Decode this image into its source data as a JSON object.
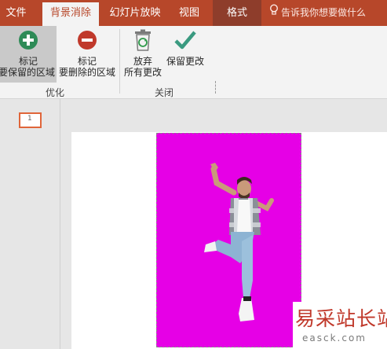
{
  "tabs": [
    {
      "label": "文件"
    },
    {
      "label": "背景消除"
    },
    {
      "label": "幻灯片放映"
    },
    {
      "label": "视图"
    },
    {
      "label": "格式"
    }
  ],
  "tell_me": "告诉我你想要做什么",
  "ribbon": {
    "mark_keep": {
      "line1": "标记",
      "line2": "要保留的区域",
      "icon": "plus-circle-icon"
    },
    "mark_remove": {
      "line1": "标记",
      "line2": "要删除的区域",
      "icon": "minus-circle-icon"
    },
    "discard": {
      "line1": "放弃",
      "line2": "所有更改",
      "icon": "recycle-bin-icon"
    },
    "keep": {
      "line1": "保留更改",
      "icon": "checkmark-icon"
    },
    "group_refine": "优化",
    "group_close": "关闭"
  },
  "thumbnails": [
    {
      "number": "1"
    }
  ],
  "colors": {
    "accent": "#b7472a",
    "background_removal_fill": "#e600e6",
    "keep_icon": "#2e8b57",
    "remove_icon": "#c0392b",
    "confirm_icon": "#3a9a80"
  },
  "watermark": {
    "cn": "易采站长站",
    "en": "easck.com"
  }
}
